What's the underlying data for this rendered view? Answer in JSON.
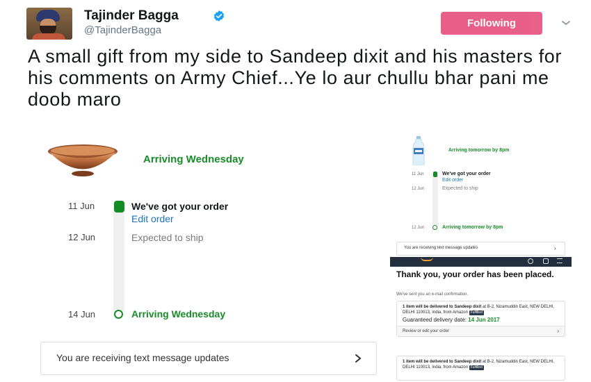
{
  "tweet": {
    "display_name": "Tajinder Bagga",
    "handle": "@TajinderBagga",
    "follow_label": "Following",
    "text": "A small gift from my side to Sandeep dixit and his masters for his comments on Army Chief...Ye lo aur chullu bhar pani me doob maro"
  },
  "left_order": {
    "title": "Arriving Wednesday",
    "steps": [
      {
        "date": "11 Jun",
        "title": "We've got your order",
        "link": "Edit order"
      },
      {
        "date": "12 Jun",
        "title": "Expected to ship"
      },
      {
        "date": "14 Jun",
        "title": "Arriving Wednesday"
      }
    ],
    "sms": "You are receiving text message updates"
  },
  "right_order": {
    "title": "Arriving tomorrow by 8pm",
    "steps": [
      {
        "date": "11 Jun",
        "title": "We've got your order",
        "link": "Edit order"
      },
      {
        "date": "12 Jun",
        "title": "Expected to ship"
      },
      {
        "date": "12 Jun",
        "title": "Arriving tomorrow by 8pm"
      }
    ],
    "sms": "You are receiving text message updates",
    "thank_you": "Thank you, your order has been placed.",
    "confirmation": "We've sent you an e-mail confirmation.",
    "cards": [
      {
        "line1": "1 item will be delivered to Sandeep dixit",
        "address": "at B-2, Nizamuddin East, NEW DELHI, DELHI 110013, India, from Amazon",
        "badge": "Fulfilled",
        "guarantee_label": "Guaranteed delivery date:",
        "guarantee_date": "14 Jun 2017",
        "footer": "Review or edit your order"
      },
      {
        "line1": "1 item will be delivered to Sandeep dixit",
        "address": "at B-2, Nizamuddin East, NEW DELHI, DELHI 110013, India, from Amazon",
        "badge": "Fulfilled"
      }
    ]
  },
  "colors": {
    "follow": "#e0245e",
    "verified": "#1da1f2",
    "green": "#178c28",
    "link": "#1a73b8"
  },
  "icons": [
    "verified-badge-icon",
    "chevron-down-icon",
    "chevron-right-icon",
    "copper-bowl-image",
    "water-bottle-image"
  ]
}
